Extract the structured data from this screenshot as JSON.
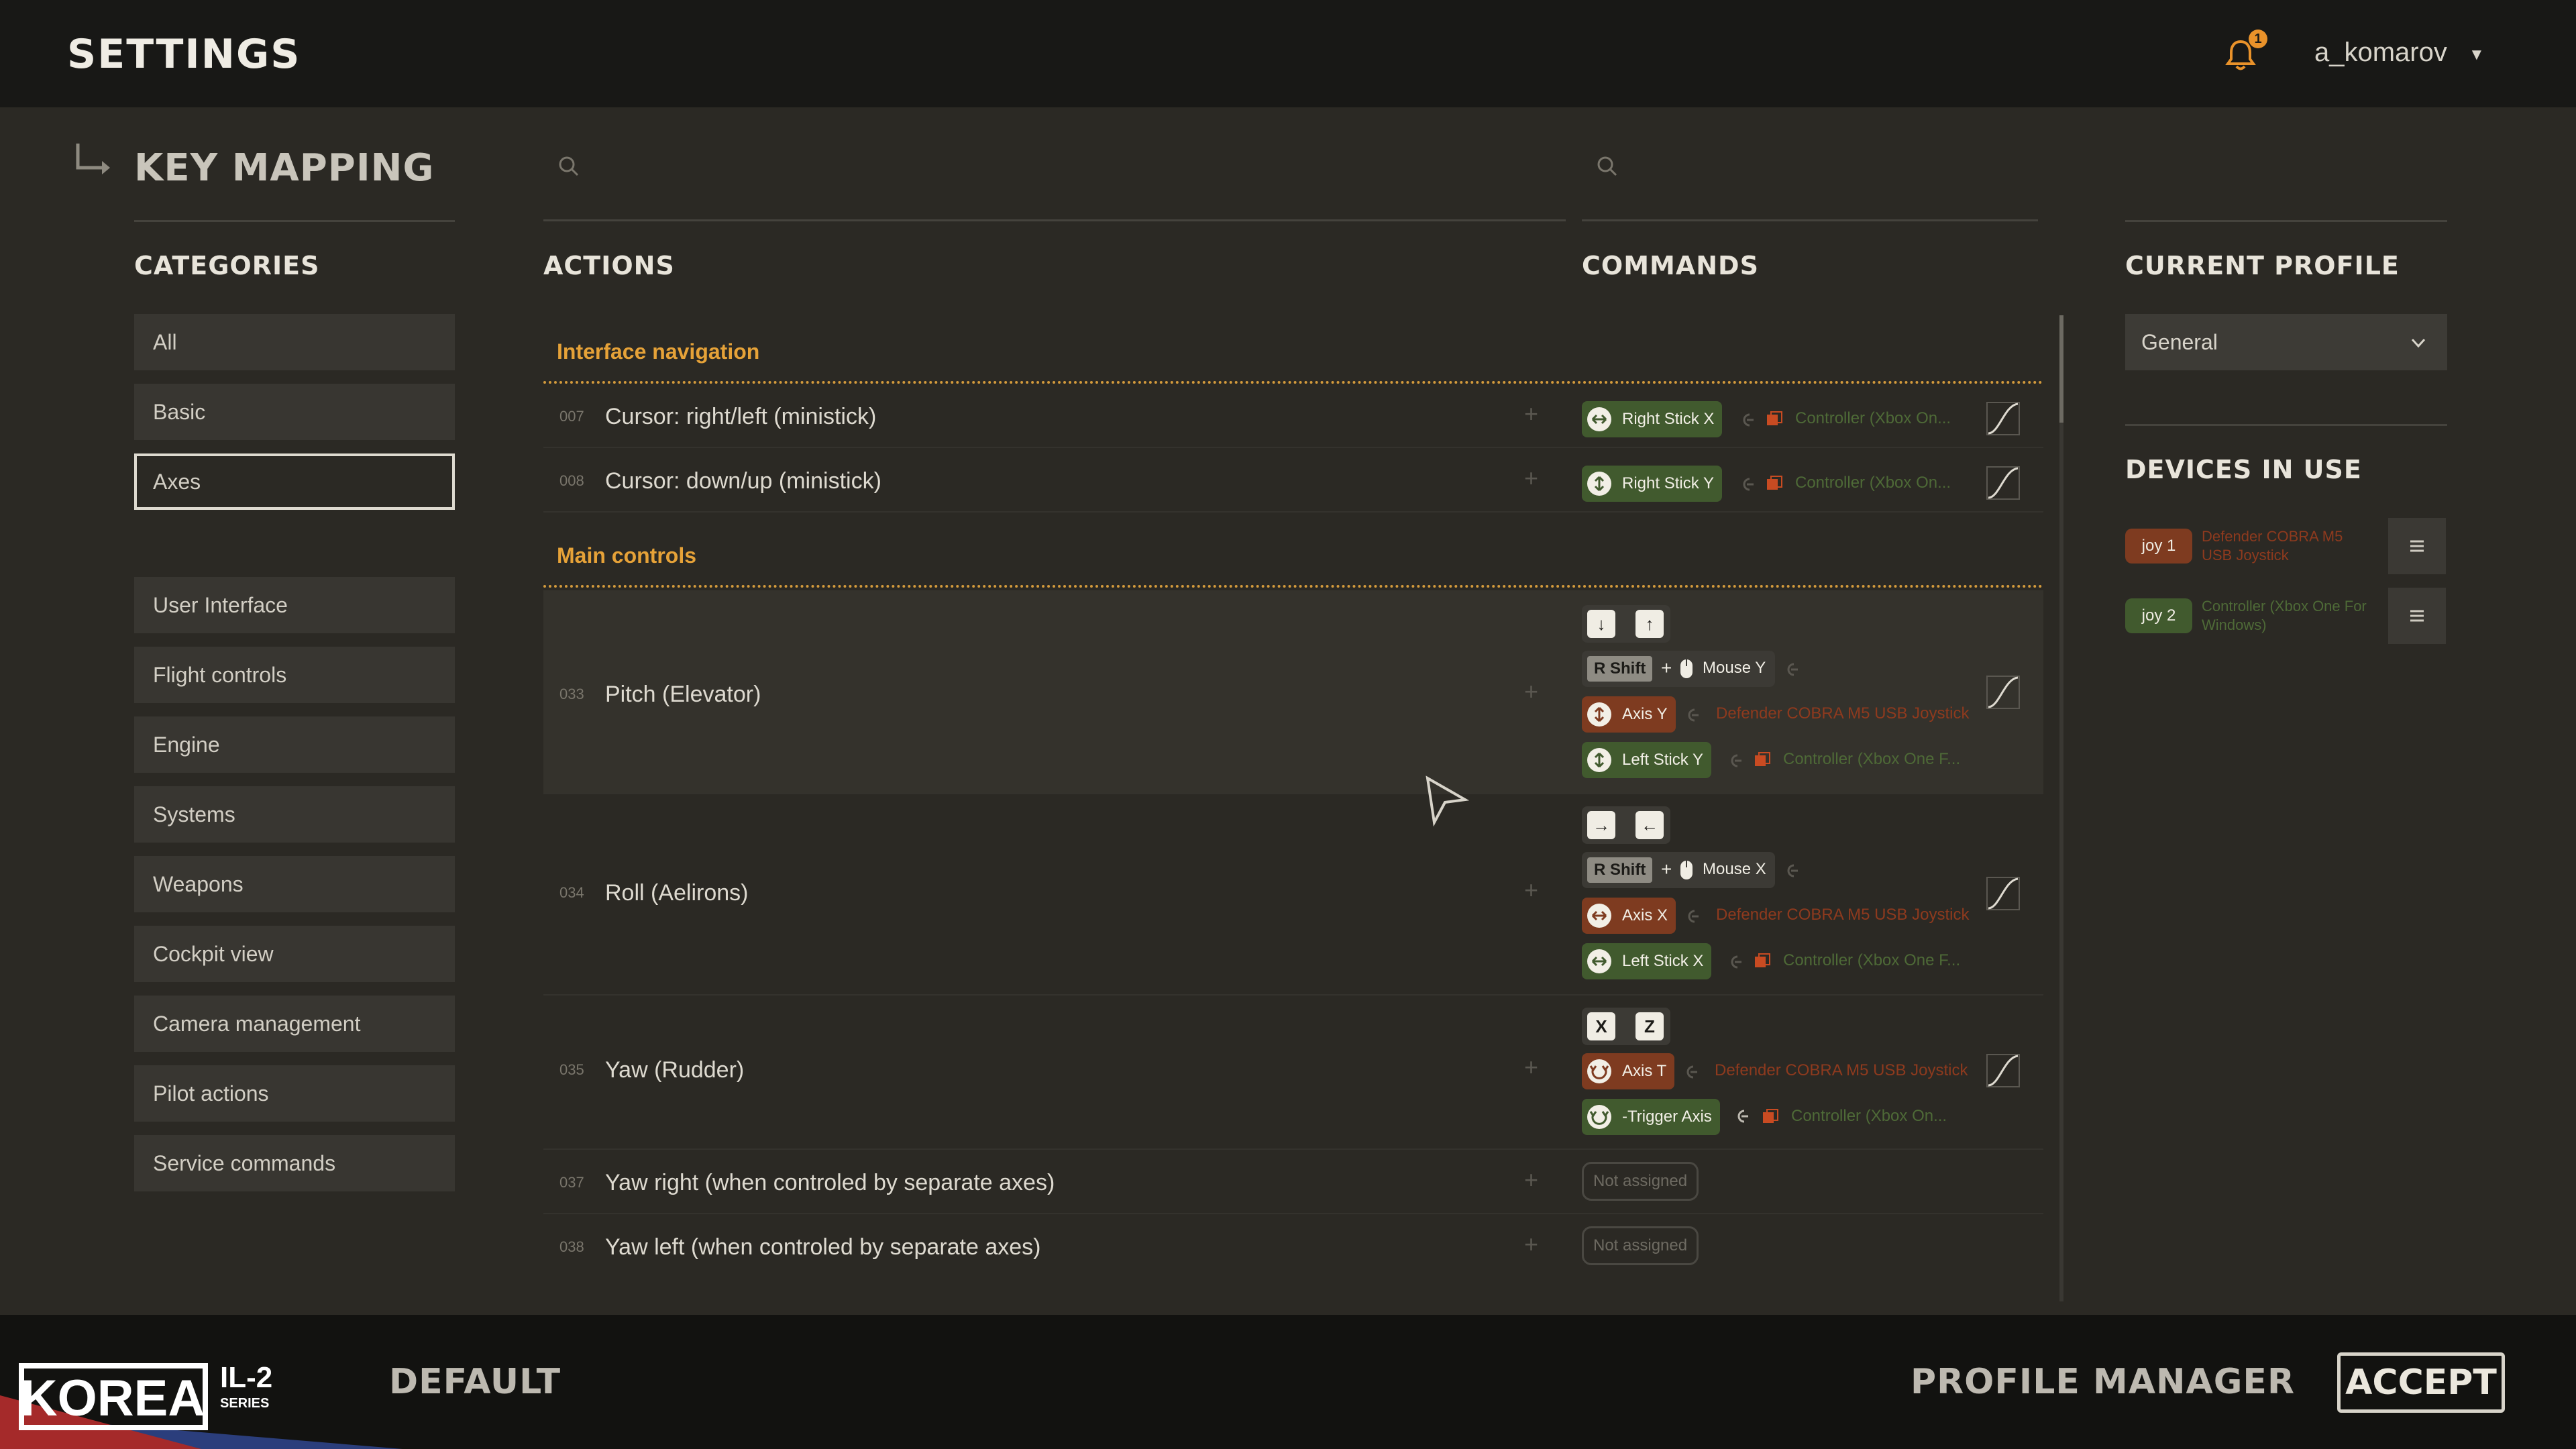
{
  "header": {
    "title": "SETTINGS",
    "notification_count": "1",
    "username": "a_komarov"
  },
  "page": {
    "title": "KEY MAPPING"
  },
  "columns": {
    "categories": "CATEGORIES",
    "actions": "ACTIONS",
    "commands": "COMMANDS",
    "current_profile": "CURRENT PROFILE",
    "devices_in_use": "DEVICES IN USE"
  },
  "categories": {
    "items": [
      "All",
      "Basic",
      "Axes",
      "User Interface",
      "Flight controls",
      "Engine",
      "Systems",
      "Weapons",
      "Cockpit view",
      "Camera management",
      "Pilot actions",
      "Service commands"
    ],
    "selected": "Axes"
  },
  "groups": [
    "Interface navigation",
    "Main controls"
  ],
  "actions": [
    {
      "num": "007",
      "name": "Cursor: right/left (ministick)"
    },
    {
      "num": "008",
      "name": "Cursor: down/up (ministick)"
    },
    {
      "num": "033",
      "name": "Pitch (Elevator)"
    },
    {
      "num": "034",
      "name": "Roll (Aelirons)"
    },
    {
      "num": "035",
      "name": "Yaw (Rudder)"
    },
    {
      "num": "037",
      "name": "Yaw right (when controled by separate axes)"
    },
    {
      "num": "038",
      "name": "Yaw left (when controled by separate axes)"
    }
  ],
  "commands": {
    "right_stick_x": "Right Stick X",
    "right_stick_y": "Right Stick Y",
    "controller_short": "Controller (Xbox On...",
    "controller_medium": "Controller (Xbox One F...",
    "defender": "Defender COBRA M5 USB Joystick",
    "r_shift": "R Shift",
    "plus": "+",
    "mouse_y": "Mouse Y",
    "mouse_x": "Mouse X",
    "axis_y": "Axis Y",
    "axis_x": "Axis X",
    "axis_t": "Axis T",
    "left_stick_y": "Left Stick Y",
    "left_stick_x": "Left Stick X",
    "trigger_axis": "-Trigger Axis",
    "key_x": "X",
    "key_z": "Z",
    "not_assigned": "Not assigned"
  },
  "profile": {
    "selected": "General"
  },
  "devices": [
    {
      "badge": "joy 1",
      "name": "Defender COBRA M5 USB Joystick",
      "color": "#7e3b20"
    },
    {
      "badge": "joy 2",
      "name": "Controller (Xbox One For Windows)",
      "color": "#415a2e"
    }
  ],
  "footer": {
    "logo_text": "KOREA",
    "logo_series": "IL-2 SERIES",
    "default": "DEFAULT",
    "profile_manager": "PROFILE MANAGER",
    "accept": "ACCEPT"
  },
  "colors": {
    "accent": "#e6a238",
    "orange_device": "#7e3b20",
    "green_device": "#415a2e",
    "background": "#2b2924"
  }
}
